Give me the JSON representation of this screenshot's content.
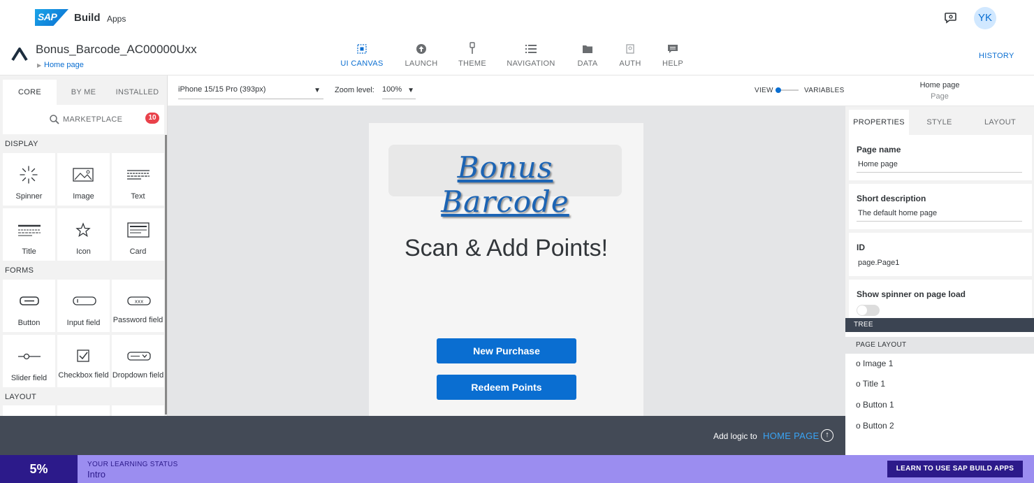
{
  "brand": {
    "logo_text": "SAP",
    "product": "Build",
    "sub": "Apps"
  },
  "user": {
    "initials": "YK"
  },
  "app": {
    "name": "Bonus_Barcode_AC00000Uxx",
    "breadcrumb": "Home page"
  },
  "nav": [
    {
      "label": "UI CANVAS",
      "icon": "canvas-icon",
      "active": true
    },
    {
      "label": "LAUNCH",
      "icon": "launch-icon"
    },
    {
      "label": "THEME",
      "icon": "theme-icon"
    },
    {
      "label": "NAVIGATION",
      "icon": "navigation-icon"
    },
    {
      "label": "DATA",
      "icon": "data-icon"
    },
    {
      "label": "AUTH",
      "icon": "auth-icon"
    },
    {
      "label": "HELP",
      "icon": "help-icon"
    }
  ],
  "history_label": "HISTORY",
  "left_tabs": [
    "CORE",
    "BY ME",
    "INSTALLED"
  ],
  "marketplace": {
    "label": "MARKETPLACE",
    "count": "10"
  },
  "sections": {
    "display": "DISPLAY",
    "forms": "FORMS",
    "layout": "LAYOUT"
  },
  "components": {
    "display": [
      "Spinner",
      "Image",
      "Text",
      "Title",
      "Icon",
      "Card"
    ],
    "forms": [
      "Button",
      "Input field",
      "Password field",
      "Slider field",
      "Checkbox field",
      "Dropdown field"
    ]
  },
  "toolbar": {
    "device": "iPhone 15/15 Pro (393px)",
    "zoom_label": "Zoom level:",
    "zoom_value": "100%",
    "view_label": "VIEW",
    "variables_label": "VARIABLES",
    "page_title": "Home page",
    "page_sub": "Page"
  },
  "canvas": {
    "logo_text": "Bonus Barcode",
    "title": "Scan & Add Points!",
    "buttons": [
      "New Purchase",
      "Redeem Points"
    ]
  },
  "logic": {
    "text": "Add logic to",
    "link": "HOME PAGE"
  },
  "right_tabs": [
    "PROPERTIES",
    "STYLE",
    "LAYOUT"
  ],
  "properties": {
    "page_name_h": "Page name",
    "page_name": "Home page",
    "short_desc_h": "Short description",
    "short_desc": "The default home page",
    "id_h": "ID",
    "id": "page.Page1",
    "spinner_h": "Show spinner on page load"
  },
  "tree": {
    "header": "TREE",
    "sub": "PAGE LAYOUT",
    "items": [
      "o Image 1",
      "o Title 1",
      "o Button 1",
      "o Button 2"
    ]
  },
  "learning": {
    "percent": "5%",
    "heading": "YOUR LEARNING STATUS",
    "value": "Intro",
    "button": "LEARN TO USE SAP BUILD APPS"
  },
  "colors": {
    "accent": "#0a6ed1",
    "learn_dark": "#2c1a8a",
    "learn_light": "#9b8df0",
    "logic_bar": "#434a56"
  }
}
